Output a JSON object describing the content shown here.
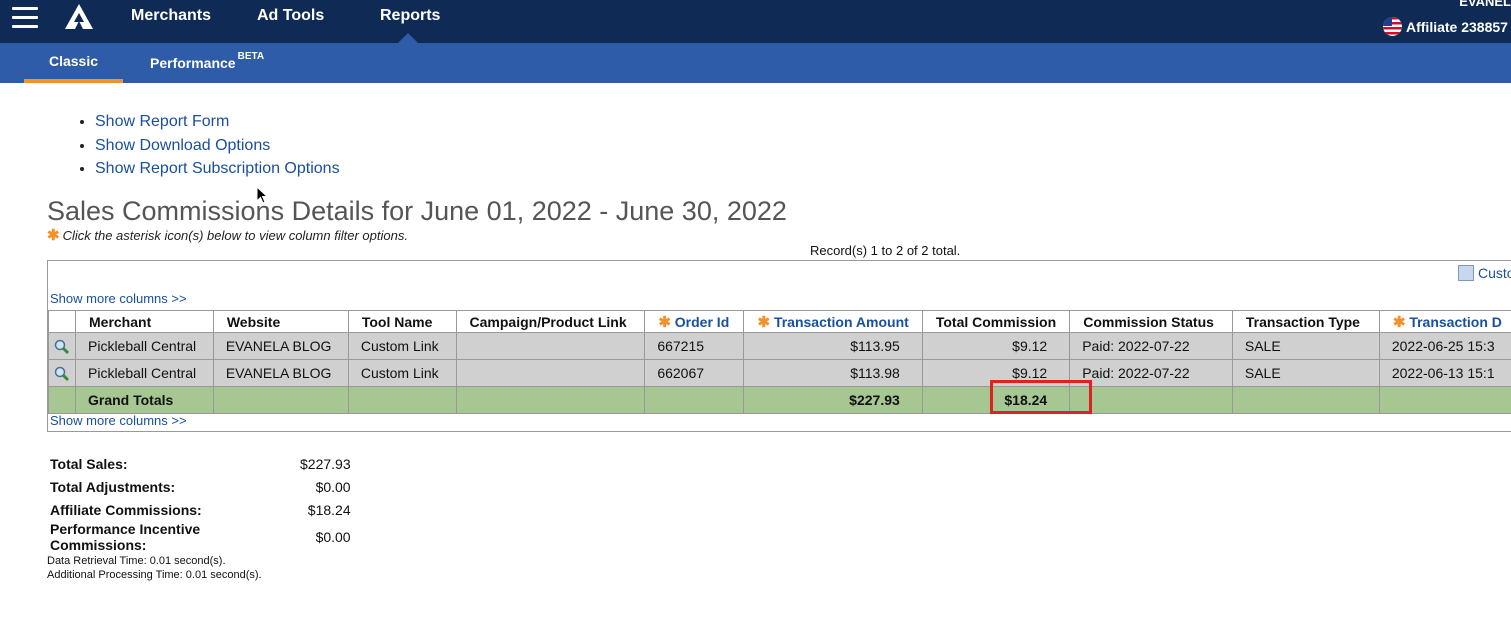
{
  "top_nav": {
    "items": [
      "Merchants",
      "Ad Tools",
      "Reports"
    ],
    "user_name": "EVANEL",
    "affiliate_label": "Affiliate 238857"
  },
  "sub_nav": {
    "classic": "Classic",
    "performance": "Performance",
    "performance_badge": "BETA"
  },
  "links": [
    "Show Report Form",
    "Show Download Options",
    "Show Report Subscription Options"
  ],
  "report": {
    "title": "Sales Commissions Details for June 01, 2022 - June 30, 2022",
    "note": "Click the asterisk icon(s) below to view column filter options.",
    "records": "Record(s) 1 to 2 of 2 total.",
    "customize": "Custo",
    "show_more_columns": "Show more columns >>",
    "columns": [
      "Merchant",
      "Website",
      "Tool Name",
      "Campaign/Product Link",
      "Order Id",
      "Transaction Amount",
      "Total Commission",
      "Commission Status",
      "Transaction Type",
      "Transaction D"
    ],
    "rows": [
      [
        "Pickleball Central",
        "EVANELA BLOG",
        "Custom Link",
        "",
        "667215",
        "$113.95",
        "$9.12",
        "Paid: 2022-07-22",
        "SALE",
        "2022-06-25 15:3"
      ],
      [
        "Pickleball Central",
        "EVANELA BLOG",
        "Custom Link",
        "",
        "662067",
        "$113.98",
        "$9.12",
        "Paid: 2022-07-22",
        "SALE",
        "2022-06-13 15:1"
      ]
    ],
    "totals": {
      "label": "Grand Totals",
      "transaction_amount": "$227.93",
      "total_commission": "$18.24"
    }
  },
  "summary": [
    {
      "label": "Total Sales:",
      "value": "$227.93"
    },
    {
      "label": "Total Adjustments:",
      "value": "$0.00"
    },
    {
      "label": "Affiliate Commissions:",
      "value": "$18.24"
    },
    {
      "label": "Performance Incentive Commissions:",
      "value": "$0.00"
    }
  ],
  "timing": {
    "retrieval": "Data Retrieval Time: 0.01 second(s).",
    "processing": "Additional Processing Time: 0.01 second(s)."
  },
  "colors": {
    "top_nav_bg": "#0f2a55",
    "sub_nav_bg": "#2e5ca8",
    "active_tab_underline": "#f3922c",
    "link": "#1a4f9c",
    "row_bg": "#d0d0d0",
    "totals_bg": "#a6c692",
    "highlight_border": "#e22020"
  }
}
